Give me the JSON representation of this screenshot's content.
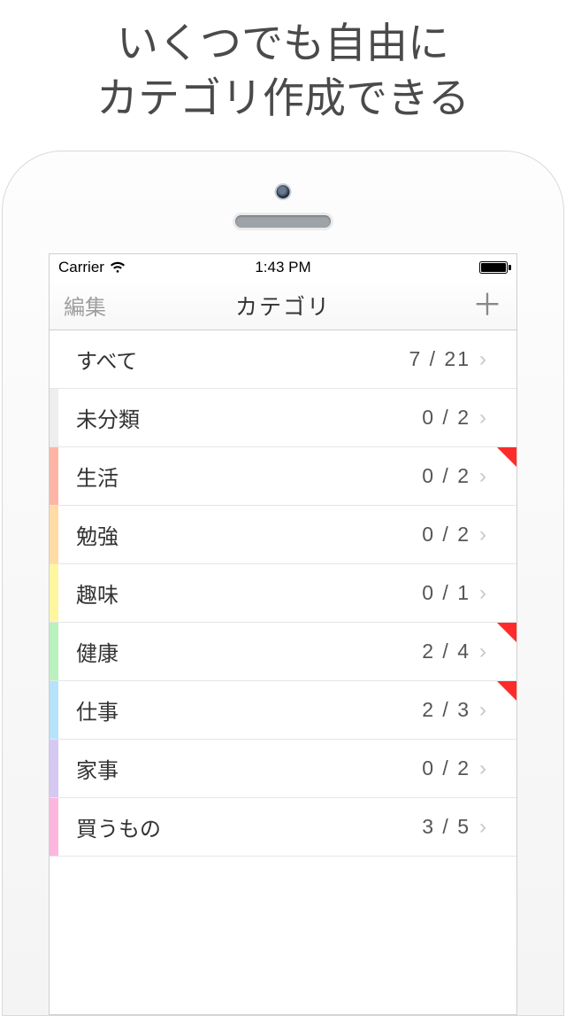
{
  "headline": {
    "line1": "いくつでも自由に",
    "line2": "カテゴリ作成できる"
  },
  "status": {
    "carrier": "Carrier",
    "time": "1:43 PM"
  },
  "nav": {
    "edit_label": "編集",
    "title": "カテゴリ",
    "add_label": "＋"
  },
  "categories": [
    {
      "label": "すべて",
      "count": "7 / 21",
      "color": "transparent",
      "flag": false
    },
    {
      "label": "未分類",
      "count": "0 / 2",
      "color": "#eeeeee",
      "flag": false
    },
    {
      "label": "生活",
      "count": "0 / 2",
      "color": "#ffb5a6",
      "flag": true
    },
    {
      "label": "勉強",
      "count": "0 / 2",
      "color": "#ffdca6",
      "flag": false
    },
    {
      "label": "趣味",
      "count": "0 / 1",
      "color": "#fff7a0",
      "flag": false
    },
    {
      "label": "健康",
      "count": "2 / 4",
      "color": "#b9f2be",
      "flag": true
    },
    {
      "label": "仕事",
      "count": "2 / 3",
      "color": "#b6e2fb",
      "flag": true
    },
    {
      "label": "家事",
      "count": "0 / 2",
      "color": "#d6c8f2",
      "flag": false
    },
    {
      "label": "買うもの",
      "count": "3 / 5",
      "color": "#ffb6de",
      "flag": false
    }
  ]
}
